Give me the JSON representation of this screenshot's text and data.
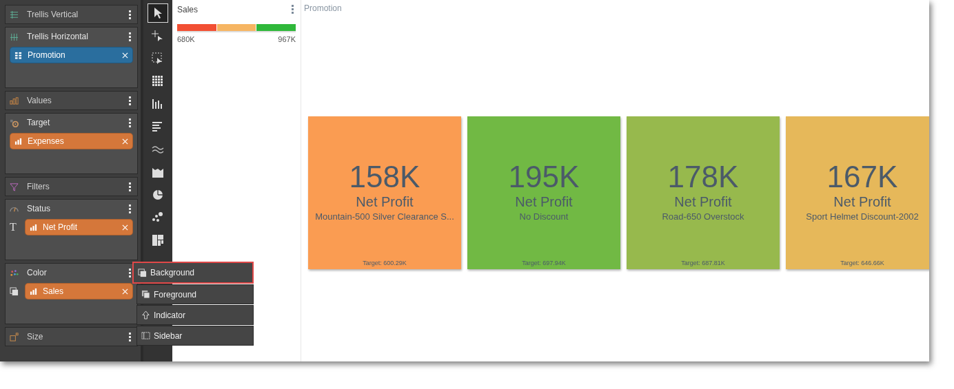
{
  "field_wells": [
    {
      "label": "Trellis Vertical"
    },
    {
      "label": "Trellis Horizontal",
      "chips": [
        {
          "label": "Promotion",
          "color": "#2a6e9e"
        }
      ]
    },
    {
      "label": "Values"
    },
    {
      "label": "Target",
      "chips": [
        {
          "label": "Expenses",
          "color": "#d5773a"
        }
      ]
    },
    {
      "label": "Filters"
    },
    {
      "label": "Status",
      "prefix": "T",
      "chips": [
        {
          "label": "Net Profit",
          "color": "#d5773a"
        }
      ]
    },
    {
      "label": "Color",
      "chips": [
        {
          "label": "Sales",
          "color": "#d5773a"
        }
      ]
    },
    {
      "label": "Size"
    }
  ],
  "toolbar": [
    {
      "selected": true
    },
    {
      "selected": false
    },
    {
      "selected": false
    },
    {
      "selected": false
    },
    {
      "selected": false
    },
    {
      "selected": false
    },
    {
      "selected": false
    },
    {
      "selected": false
    },
    {
      "selected": false
    },
    {
      "selected": false
    },
    {
      "selected": false
    }
  ],
  "color_menu": [
    {
      "label": "Background",
      "selected": true
    },
    {
      "label": "Foreground",
      "selected": false
    },
    {
      "label": "Indicator",
      "selected": false
    },
    {
      "label": "Sidebar",
      "selected": false
    }
  ],
  "legend": {
    "title": "Sales",
    "bands": [
      {
        "color": "#f24f33"
      },
      {
        "color": "#f6b562"
      },
      {
        "color": "#2fb83a"
      }
    ],
    "min": "680K",
    "max": "967K"
  },
  "trellis_title": "Promotion",
  "tiles": [
    {
      "value": "158K",
      "measure": "Net Profit",
      "name": "Mountain-500 Silver Clearance S...",
      "target": "Target: 600.29K",
      "color": "#fa9c52"
    },
    {
      "value": "195K",
      "measure": "Net Profit",
      "name": "No Discount",
      "target": "Target: 697.94K",
      "color": "#71b944"
    },
    {
      "value": "178K",
      "measure": "Net Profit",
      "name": "Road-650 Overstock",
      "target": "Target: 687.81K",
      "color": "#97b94d"
    },
    {
      "value": "167K",
      "measure": "Net Profit",
      "name": "Sport Helmet Discount-2002",
      "target": "Target: 646.66K",
      "color": "#e6b85a"
    }
  ]
}
